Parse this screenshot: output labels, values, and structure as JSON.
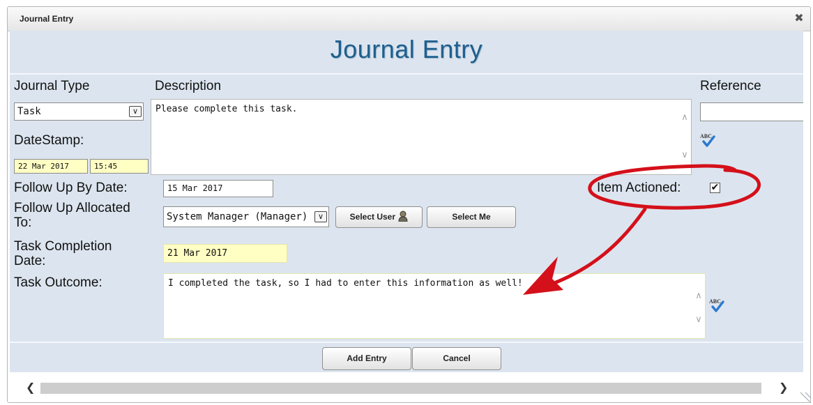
{
  "window": {
    "title": "Journal Entry"
  },
  "heading": "Journal Entry",
  "labels": {
    "journal_type": "Journal Type",
    "description": "Description",
    "reference": "Reference",
    "datestamp": "DateStamp:",
    "follow_up_by_date": "Follow Up By Date:",
    "follow_up_allocated_1": "Follow Up Allocated",
    "follow_up_allocated_2": "To:",
    "task_completion_1": "Task Completion",
    "task_completion_2": "Date:",
    "task_outcome": "Task Outcome:",
    "item_actioned": "Item Actioned:"
  },
  "fields": {
    "journal_type": "Task",
    "description": "Please complete this task.",
    "reference": "",
    "date": "22 Mar 2017",
    "time": "15:45",
    "follow_up_by_date": "15 Mar 2017",
    "allocated_to": "System Manager (Manager)",
    "task_completion_date": "21 Mar 2017",
    "task_outcome": "I completed the task, so I had to enter this information as well!",
    "item_actioned_checked": true
  },
  "buttons": {
    "select_user": "Select User",
    "select_me": "Select Me",
    "add_entry": "Add Entry",
    "cancel": "Cancel"
  },
  "icons": {
    "close": "close-icon",
    "spellcheck_icon_text": "ABC",
    "check_mark": "✔",
    "scroll_up": "∧",
    "scroll_down": "∨",
    "scroll_left": "❮",
    "scroll_right": "❯",
    "dropdown": "∨",
    "close_glyph": "✖"
  },
  "colors": {
    "heading": "#1d5f8e",
    "panel_bg": "#dce5ef",
    "field_yellow": "#ffffc4",
    "annotation_red": "#d4101a"
  }
}
